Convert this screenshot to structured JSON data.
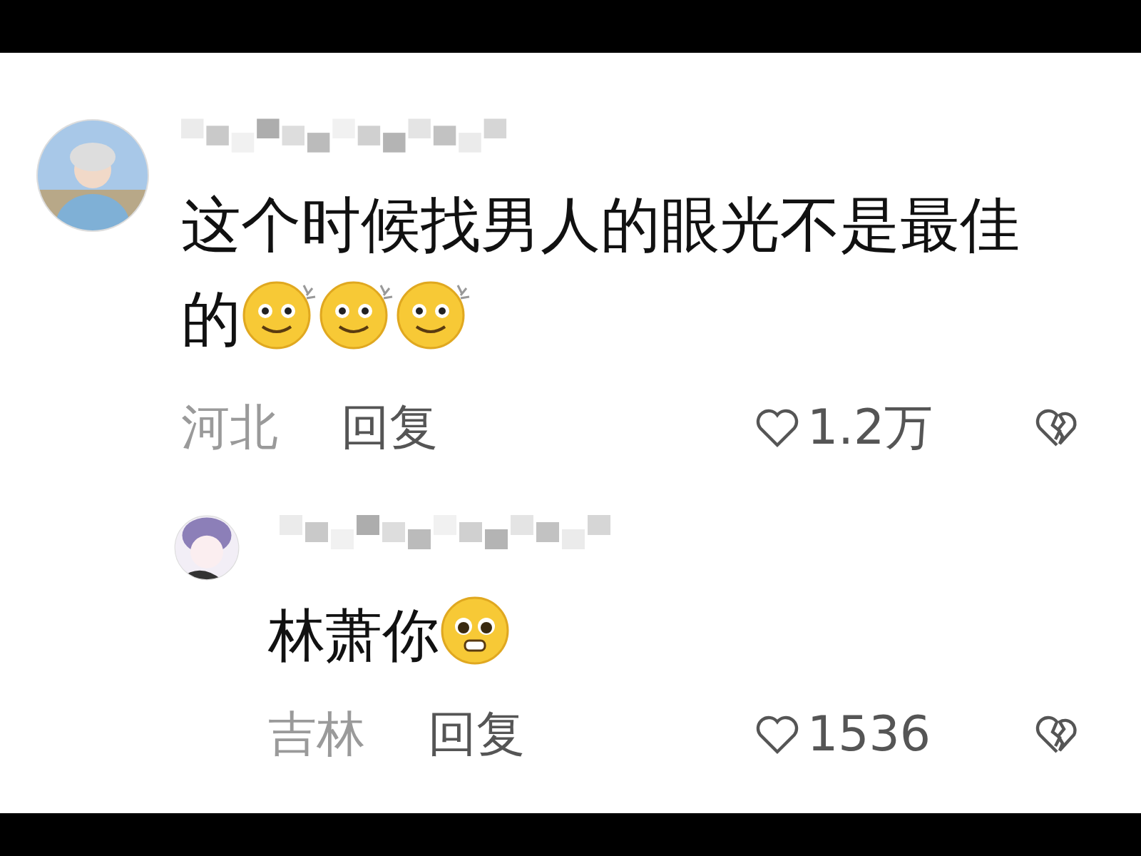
{
  "comments": [
    {
      "text": "这个时候找男人的眼光不是最佳的",
      "emojis": [
        {
          "kind": "dazed"
        },
        {
          "kind": "dazed"
        },
        {
          "kind": "dazed"
        }
      ],
      "location": "河北",
      "reply_label": "回复",
      "likes": "1.2万",
      "replies": [
        {
          "text": "林萧你",
          "emojis": [
            {
              "kind": "pleading"
            }
          ],
          "location": "吉林",
          "reply_label": "回复",
          "likes": "1536",
          "avatar": {
            "kind": "anime"
          }
        }
      ]
    }
  ]
}
